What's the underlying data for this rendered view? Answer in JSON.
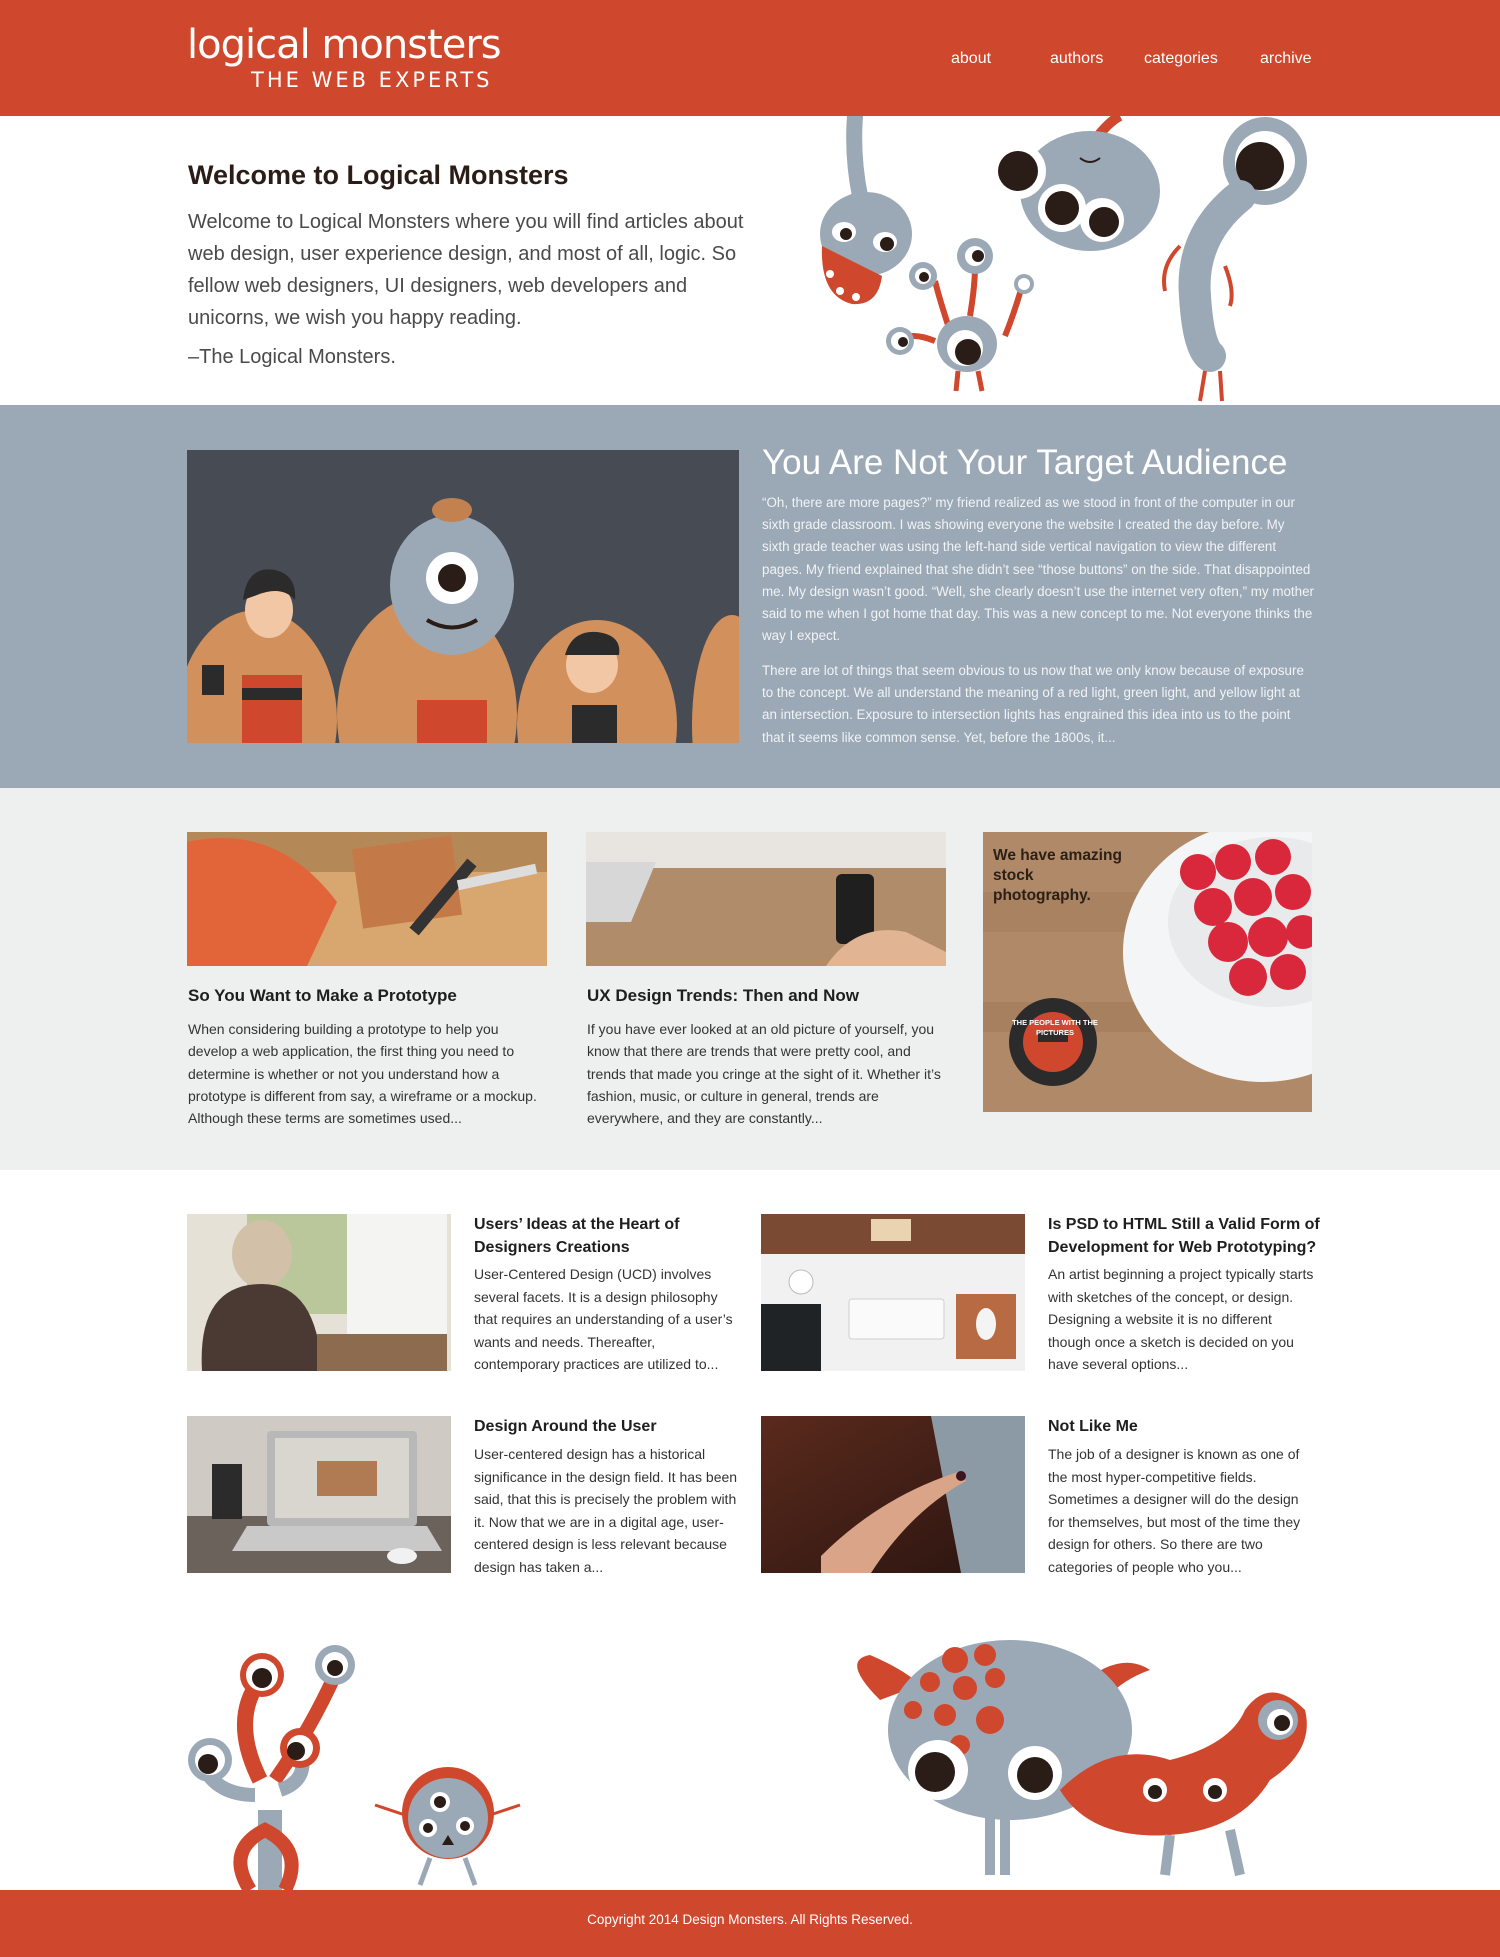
{
  "header": {
    "logo_main": "logical monsters",
    "logo_sub": "THE WEB EXPERTS",
    "nav": [
      "about",
      "authors",
      "categories",
      "archive"
    ]
  },
  "intro": {
    "title": "Welcome to Logical Monsters",
    "text": "Welcome to Logical Monsters where you will find articles about web design, user experience design, and most of all, logic. So fellow web designers, UI designers, web developers and unicorns, we wish you happy reading.",
    "signature": "–The Logical Monsters."
  },
  "featured": {
    "title": "You Are Not Your Target Audience",
    "p1": "“Oh, there are more pages?” my friend realized as we stood in front of the computer in our sixth grade classroom. I was showing everyone the website I created the day before. My sixth grade teacher was using the left-hand side vertical navigation to view the different pages. My friend explained that she didn’t see “those buttons” on the side. That disappointed me. My design wasn’t good. “Well, she clearly doesn’t use the internet very often,” my mother said to me when I got home that day. This was a new concept to me. Not everyone thinks the way I expect.",
    "p2": "There are lot of things that seem obvious to us now that we only know because of exposure to the concept. We all understand the meaning of a red light, green light, and yellow light at an intersection. Exposure to intersection lights has engrained this idea into us to the point that it seems like common sense. Yet, before the 1800s, it..."
  },
  "cards": [
    {
      "title": "So You Want to Make a Prototype",
      "text": "When considering building a prototype to help you develop a web application, the first thing you need to determine is whether or not you understand how a prototype is different from say, a wireframe or a mockup. Although these terms are sometimes used..."
    },
    {
      "title": "UX Design Trends: Then and Now",
      "text": "If you have ever looked at an old picture of yourself, you know that there are trends that were pretty cool, and trends that made you cringe at the sight of it. Whether it’s fashion, music, or culture in general, trends are everywhere, and they are constantly..."
    }
  ],
  "ad": {
    "text": "We have amazing stock photography.",
    "badge": "THE PEOPLE WITH THE PICTURES"
  },
  "list": [
    {
      "title": "Users’ Ideas at the Heart of Designers Creations",
      "text": "User-Centered Design (UCD) involves several facets. It is a design philosophy that requires an understanding of a user’s wants and needs. Thereafter, contemporary practices are utilized to..."
    },
    {
      "title": "Is PSD to HTML Still a Valid Form of Development for Web Prototyping?",
      "text": "An artist beginning a project typically starts with sketches of the concept, or design. Designing a website it is no different though once a sketch is decided on you have several options..."
    },
    {
      "title": "Design Around the User",
      "text": "User-centered design has a historical significance in the design field. It has been said, that this is precisely the problem with it. Now that we are in a digital age, user-centered design is less relevant because design has taken a..."
    },
    {
      "title": "Not Like Me",
      "text": "The job of a designer is known as one of the most hyper-competitive fields. Sometimes a designer will do the design for themselves, but most of the time they design for others. So there are two categories of people who you..."
    }
  ],
  "footer": {
    "copyright": "Copyright 2014 Design Monsters. All Rights Reserved."
  },
  "colors": {
    "brand_red": "#cf472c",
    "slate": "#9ba8b6",
    "light_gray": "#eef0ef"
  }
}
